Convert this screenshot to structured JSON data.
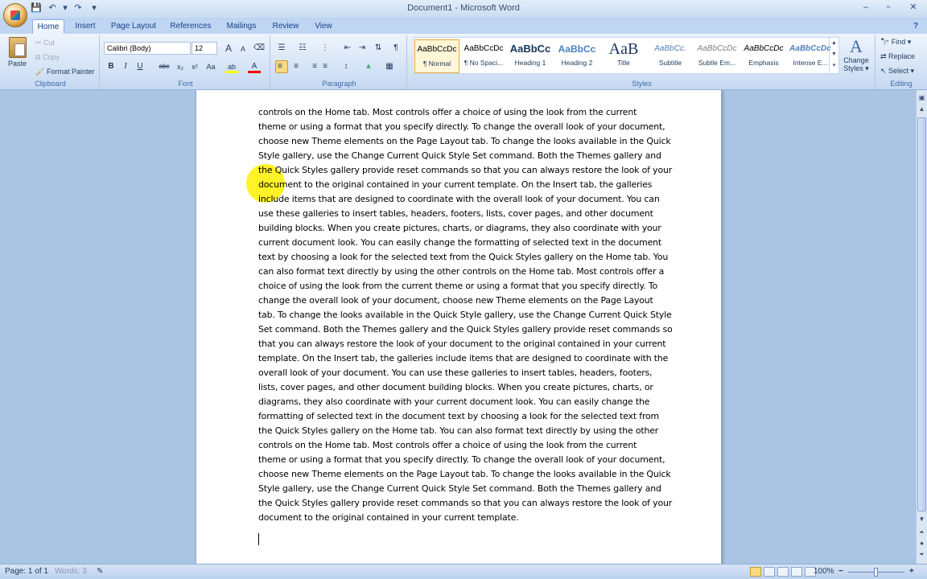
{
  "window": {
    "title": "Document1 - Microsoft Word",
    "minimize": "–",
    "maximize": "▫",
    "close": "✕"
  },
  "qat": {
    "save": "💾",
    "undo": "↶",
    "undo_drop": "▾",
    "redo": "↷",
    "customize": "▾"
  },
  "tabs": [
    "Home",
    "Insert",
    "Page Layout",
    "References",
    "Mailings",
    "Review",
    "View"
  ],
  "help": "?",
  "clipboard": {
    "label": "Clipboard",
    "paste": "Paste",
    "cut": "Cut",
    "copy": "Copy",
    "format_painter": "Format Painter"
  },
  "font": {
    "label": "Font",
    "family": "Calibri (Body)",
    "size": "12",
    "grow": "A",
    "shrink": "A",
    "clear": "⌫",
    "bold": "B",
    "italic": "I",
    "underline": "U",
    "strike": "abc",
    "subscript": "x₂",
    "superscript": "x²",
    "case": "Aa",
    "highlight": "ab",
    "color": "A"
  },
  "paragraph": {
    "label": "Paragraph",
    "bullets": "☰",
    "numbering": "☷",
    "multilevel": "⋮",
    "dec_indent": "⇤",
    "inc_indent": "⇥",
    "sort": "⇅",
    "show": "¶",
    "align_left": "≡",
    "center": "≡",
    "align_right": "≡",
    "justify": "≡",
    "line_spacing": "↕",
    "shading": "▲",
    "borders": "▦"
  },
  "styles": {
    "label": "Styles",
    "items": [
      {
        "sample": "AaBbCcDc",
        "name": "¶ Normal"
      },
      {
        "sample": "AaBbCcDc",
        "name": "¶ No Spaci..."
      },
      {
        "sample": "AaBbCc",
        "name": "Heading 1"
      },
      {
        "sample": "AaBbCc",
        "name": "Heading 2"
      },
      {
        "sample": "AaB",
        "name": "Title"
      },
      {
        "sample": "AaBbCc.",
        "name": "Subtitle"
      },
      {
        "sample": "AaBbCcDc",
        "name": "Subtle Em..."
      },
      {
        "sample": "AaBbCcDc",
        "name": "Emphasis"
      },
      {
        "sample": "AaBbCcDc",
        "name": "Intense E..."
      }
    ],
    "change_styles": "Change Styles ▾",
    "change_icon": "A"
  },
  "editing": {
    "label": "Editing",
    "find": "Find ▾",
    "replace": "Replace",
    "select": "Select ▾"
  },
  "document": {
    "lines": [
      "controls on the Home tab. Most controls offer a choice of using the look from the current",
      "theme or using a format that you specify directly. To change the overall look of your document,",
      "choose new Theme elements on the Page Layout tab. To change the looks available in the Quick",
      "Style gallery, use the Change Current Quick Style Set command. Both the Themes gallery and",
      "the Quick Styles gallery provide reset commands so that you can always restore the look of your",
      "document to the original contained in your current template. On the Insert tab, the galleries",
      "include items that are designed to coordinate with the overall look of your document. You can",
      "use these galleries to insert tables, headers, footers, lists, cover pages, and other document",
      "building blocks. When you create pictures, charts, or diagrams, they also coordinate with your",
      "current document look. You can easily change the formatting of selected text in the document",
      "text by choosing a look for the selected text from the Quick Styles gallery on the Home tab. You",
      "can also format text directly by using the other controls on the Home tab. Most controls offer a",
      "choice of using the look from the current theme or using a format that you specify directly. To",
      "change the overall look of your document, choose new Theme elements on the Page Layout",
      "tab. To change the looks available in the Quick Style gallery, use the Change Current Quick Style",
      "Set command. Both the Themes gallery and the Quick Styles gallery provide reset commands so",
      "that you can always restore the look of your document to the original contained in your current",
      "template. On the Insert tab, the galleries include items that are designed to coordinate with the",
      "overall look of your document. You can use these galleries to insert tables, headers, footers,",
      "lists, cover pages, and other document building blocks. When you create pictures, charts, or",
      "diagrams, they also coordinate with your current document look. You can easily change the",
      "formatting of selected text in the document text by choosing a look for the selected text from",
      "the Quick Styles gallery on the Home tab. You can also format text directly by using the other",
      "controls on the Home tab. Most controls offer a choice of using the look from the current",
      "theme or using a format that you specify directly. To change the overall look of your document,",
      "choose new Theme elements on the Page Layout tab. To change the looks available in the Quick",
      "Style gallery, use the Change Current Quick Style Set command. Both the Themes gallery and",
      "the Quick Styles gallery provide reset commands so that you can always restore the look of your",
      "document to the original contained in your current template."
    ]
  },
  "status": {
    "page": "Page: 1 of 1",
    "words": "Words: 3",
    "proof": "✎",
    "zoom": "100%",
    "zoom_minus": "−",
    "zoom_plus": "+"
  },
  "colors": {
    "accent": "#fbd880",
    "ribbon": "#d6e4f6",
    "workspace": "#aac4e3"
  }
}
